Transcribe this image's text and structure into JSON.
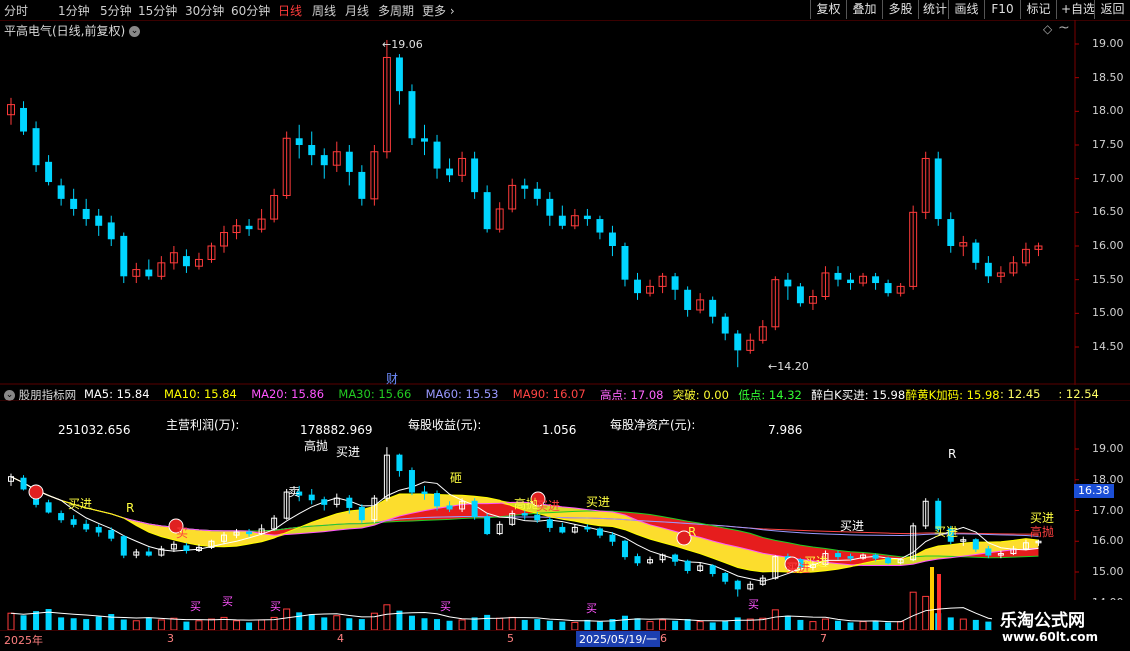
{
  "toolbar": {
    "timeframes": [
      "分时",
      "1分钟",
      "5分钟",
      "15分钟",
      "30分钟",
      "60分钟",
      "日线",
      "周线",
      "月线",
      "多周期",
      "更多"
    ],
    "active_timeframe": "日线",
    "buttons": [
      "复权",
      "叠加",
      "多股",
      "统计",
      "画线",
      "F10",
      "标记",
      "+自选",
      "返回"
    ]
  },
  "main": {
    "title": "平高电气(日线,前复权)",
    "y_ticks": [
      "19.00",
      "18.50",
      "18.00",
      "17.50",
      "17.00",
      "16.50",
      "16.00",
      "15.50",
      "15.00",
      "14.50"
    ],
    "high_label": "19.06",
    "low_label": "14.20",
    "cai_label": "财",
    "candles": [
      [
        17.95,
        18.1,
        17.8,
        18.2
      ],
      [
        18.05,
        17.7,
        17.65,
        18.15
      ],
      [
        17.75,
        17.2,
        17.1,
        17.85
      ],
      [
        17.25,
        16.95,
        16.9,
        17.35
      ],
      [
        16.9,
        16.7,
        16.6,
        17.0
      ],
      [
        16.7,
        16.55,
        16.45,
        16.85
      ],
      [
        16.55,
        16.4,
        16.3,
        16.7
      ],
      [
        16.45,
        16.3,
        16.15,
        16.55
      ],
      [
        16.35,
        16.1,
        16.0,
        16.45
      ],
      [
        16.15,
        15.55,
        15.45,
        16.2
      ],
      [
        15.55,
        15.65,
        15.45,
        15.75
      ],
      [
        15.65,
        15.55,
        15.5,
        15.8
      ],
      [
        15.55,
        15.75,
        15.5,
        15.85
      ],
      [
        15.75,
        15.9,
        15.65,
        16.0
      ],
      [
        15.85,
        15.7,
        15.6,
        15.95
      ],
      [
        15.7,
        15.8,
        15.65,
        15.9
      ],
      [
        15.8,
        16.0,
        15.75,
        16.05
      ],
      [
        16.0,
        16.2,
        15.9,
        16.3
      ],
      [
        16.2,
        16.3,
        16.1,
        16.4
      ],
      [
        16.3,
        16.25,
        16.15,
        16.4
      ],
      [
        16.25,
        16.4,
        16.2,
        16.55
      ],
      [
        16.4,
        16.75,
        16.35,
        16.85
      ],
      [
        16.75,
        17.6,
        16.7,
        17.7
      ],
      [
        17.6,
        17.5,
        17.3,
        17.8
      ],
      [
        17.5,
        17.35,
        17.2,
        17.7
      ],
      [
        17.35,
        17.2,
        17.0,
        17.45
      ],
      [
        17.2,
        17.4,
        17.1,
        17.55
      ],
      [
        17.4,
        17.1,
        16.9,
        17.5
      ],
      [
        17.1,
        16.7,
        16.6,
        17.2
      ],
      [
        16.7,
        17.4,
        16.6,
        17.5
      ],
      [
        17.4,
        18.8,
        17.3,
        19.06
      ],
      [
        18.8,
        18.3,
        18.1,
        18.85
      ],
      [
        18.3,
        17.6,
        17.5,
        18.4
      ],
      [
        17.6,
        17.55,
        17.35,
        17.8
      ],
      [
        17.55,
        17.15,
        17.0,
        17.65
      ],
      [
        17.15,
        17.05,
        16.95,
        17.3
      ],
      [
        17.05,
        17.3,
        16.95,
        17.4
      ],
      [
        17.3,
        16.8,
        16.7,
        17.4
      ],
      [
        16.8,
        16.25,
        16.2,
        16.9
      ],
      [
        16.25,
        16.55,
        16.2,
        16.65
      ],
      [
        16.55,
        16.9,
        16.5,
        17.0
      ],
      [
        16.9,
        16.85,
        16.7,
        17.0
      ],
      [
        16.85,
        16.7,
        16.6,
        16.95
      ],
      [
        16.7,
        16.45,
        16.3,
        16.8
      ],
      [
        16.45,
        16.3,
        16.25,
        16.6
      ],
      [
        16.3,
        16.45,
        16.25,
        16.55
      ],
      [
        16.45,
        16.4,
        16.3,
        16.55
      ],
      [
        16.4,
        16.2,
        16.1,
        16.45
      ],
      [
        16.2,
        16.0,
        15.85,
        16.3
      ],
      [
        16.0,
        15.5,
        15.4,
        16.05
      ],
      [
        15.5,
        15.3,
        15.2,
        15.6
      ],
      [
        15.3,
        15.4,
        15.25,
        15.5
      ],
      [
        15.4,
        15.55,
        15.3,
        15.6
      ],
      [
        15.55,
        15.35,
        15.2,
        15.6
      ],
      [
        15.35,
        15.05,
        14.95,
        15.4
      ],
      [
        15.05,
        15.2,
        15.0,
        15.3
      ],
      [
        15.2,
        14.95,
        14.85,
        15.25
      ],
      [
        14.95,
        14.7,
        14.6,
        15.0
      ],
      [
        14.7,
        14.45,
        14.2,
        14.75
      ],
      [
        14.45,
        14.6,
        14.4,
        14.7
      ],
      [
        14.6,
        14.8,
        14.55,
        14.9
      ],
      [
        14.8,
        15.5,
        14.75,
        15.55
      ],
      [
        15.5,
        15.4,
        15.2,
        15.6
      ],
      [
        15.4,
        15.15,
        15.1,
        15.45
      ],
      [
        15.15,
        15.25,
        15.05,
        15.35
      ],
      [
        15.25,
        15.6,
        15.2,
        15.7
      ],
      [
        15.6,
        15.5,
        15.4,
        15.7
      ],
      [
        15.5,
        15.45,
        15.35,
        15.6
      ],
      [
        15.45,
        15.55,
        15.4,
        15.6
      ],
      [
        15.55,
        15.45,
        15.35,
        15.6
      ],
      [
        15.45,
        15.3,
        15.25,
        15.5
      ],
      [
        15.3,
        15.4,
        15.25,
        15.45
      ],
      [
        15.4,
        16.5,
        15.35,
        16.6
      ],
      [
        16.5,
        17.3,
        16.4,
        17.4
      ],
      [
        17.3,
        16.4,
        16.3,
        17.4
      ],
      [
        16.4,
        16.0,
        15.9,
        16.5
      ],
      [
        16.0,
        16.05,
        15.85,
        16.15
      ],
      [
        16.05,
        15.75,
        15.65,
        16.1
      ],
      [
        15.75,
        15.55,
        15.45,
        15.85
      ],
      [
        15.55,
        15.6,
        15.45,
        15.7
      ],
      [
        15.6,
        15.75,
        15.55,
        15.85
      ],
      [
        15.75,
        15.95,
        15.7,
        16.05
      ],
      [
        15.95,
        16.0,
        15.85,
        16.05
      ]
    ],
    "cyan_highlight_dates_note": ""
  },
  "indicator": {
    "name": "股朋指标网",
    "items": [
      {
        "text": "MA5: 15.84",
        "color": "#ffffff"
      },
      {
        "text": "MA10: 15.84",
        "color": "#ffff00"
      },
      {
        "text": "MA20: 15.86",
        "color": "#ff55ff"
      },
      {
        "text": "MA30: 15.66",
        "color": "#22cc22"
      },
      {
        "text": "MA60: 15.53",
        "color": "#9999ff"
      },
      {
        "text": "MA90: 16.07",
        "color": "#ff4444"
      },
      {
        "text": "高点: 17.08",
        "color": "#ff66ff"
      },
      {
        "text": "突破: 0.00",
        "color": "#ffff33"
      },
      {
        "text": "低点: 14.32",
        "color": "#33ff33"
      },
      {
        "text": "醉白K买进: 15.98",
        "color": "#ffffff"
      },
      {
        "text": "醉黄K加码: 15.98",
        "color": "#ffff00"
      },
      {
        "text": ": 12.45",
        "color": "#ffff66"
      },
      {
        "text": ": 12.54",
        "color": "#ffff66"
      }
    ],
    "info_labels": [
      "251032.656",
      "主营利润(万):",
      "178882.969",
      "每股收益(元):",
      "1.056",
      "每股净资产(元):",
      "7.986"
    ],
    "y_ticks": [
      "19.00",
      "18.00",
      "17.00",
      "16.00",
      "15.00",
      "14.00"
    ],
    "current_price_tag": "16.38",
    "signals": [
      "买进",
      "卖",
      "买",
      "R",
      "买进",
      "高抛",
      "砸",
      "高抛",
      "买进",
      "买进",
      "R",
      "买进",
      "买进",
      "买进",
      "买进",
      "R",
      "高抛",
      "买进",
      "砸",
      "跟",
      "买进"
    ]
  },
  "volume": {
    "bars": [
      40,
      35,
      45,
      50,
      30,
      28,
      26,
      32,
      38,
      25,
      22,
      30,
      24,
      28,
      20,
      22,
      26,
      30,
      22,
      18,
      24,
      30,
      50,
      42,
      38,
      30,
      34,
      28,
      26,
      40,
      60,
      46,
      34,
      28,
      26,
      22,
      24,
      30,
      36,
      28,
      30,
      24,
      26,
      22,
      20,
      18,
      24,
      20,
      26,
      34,
      28,
      20,
      24,
      22,
      26,
      20,
      18,
      22,
      30,
      26,
      28,
      48,
      34,
      24,
      20,
      26,
      22,
      18,
      20,
      22,
      18,
      20,
      90,
      80,
      40,
      30,
      26,
      24,
      20,
      18,
      22,
      26,
      20
    ],
    "labels": [
      "买",
      "买",
      "买",
      "买",
      "买",
      "买"
    ]
  },
  "dates": {
    "labels": [
      "2025年",
      "3",
      "4",
      "5",
      "6",
      "7"
    ],
    "highlight": "2025/05/19/一"
  },
  "watermark": {
    "title": "乐淘公式网",
    "url": "www.60lt.com"
  },
  "colors": {
    "up": "#ff3b3b",
    "down": "#00d5ff",
    "ma5": "#ffffff",
    "ma10": "#ffff00",
    "ma20": "#ff55ff",
    "ma30": "#22cc22",
    "ma60": "#9999ff",
    "ma90": "#ff4444"
  }
}
